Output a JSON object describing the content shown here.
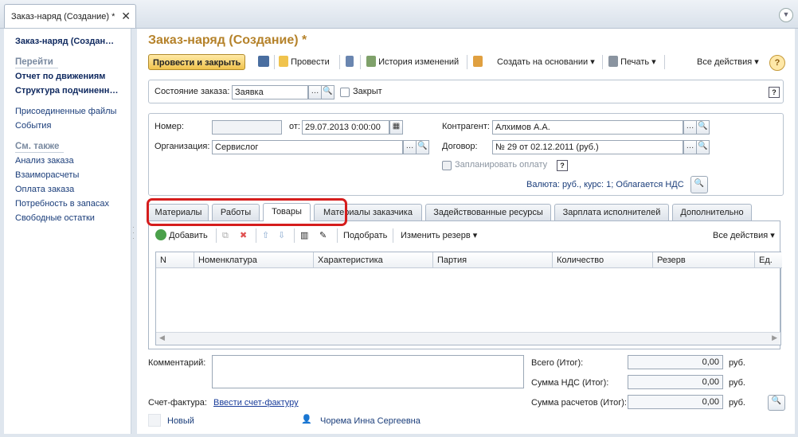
{
  "window": {
    "tab_title": "Заказ-наряд (Создание) *",
    "close_symbol": "✕"
  },
  "sidebar": {
    "title": "Заказ-наряд (Создан…",
    "goto_header": "Перейти",
    "goto_items": [
      "Отчет по движениям",
      "Структура подчиненн…"
    ],
    "misc_items": [
      "Присоединенные файлы",
      "События"
    ],
    "see_also_header": "См. также",
    "see_also_items": [
      "Анализ заказа",
      "Взаиморасчеты",
      "Оплата заказа",
      "Потребность в запасах",
      "Свободные остатки"
    ]
  },
  "header": {
    "title": "Заказ-наряд (Создание) *"
  },
  "toolbar": {
    "post_close": "Провести и закрыть",
    "post": "Провести",
    "history": "История изменений",
    "create_based": "Создать на основании",
    "print": "Печать",
    "all_actions": "Все действия",
    "help": "?"
  },
  "state_panel": {
    "state_label": "Состояние заказа:",
    "state_value": "Заявка",
    "closed_label": "Закрыт",
    "help": "?"
  },
  "form": {
    "number_label": "Номер:",
    "number_value": "",
    "from_label": "от:",
    "date_value": "29.07.2013  0:00:00",
    "org_label": "Организация:",
    "org_value": "Сервислог",
    "counterparty_label": "Контрагент:",
    "counterparty_value": "Алхимов А.А.",
    "contract_label": "Договор:",
    "contract_value": "№ 29 от 02.12.2011 (руб.)",
    "plan_payment_label": "Запланировать оплату",
    "currency_info": "Валюта: руб., курс: 1; Облагается НДС",
    "help": "?"
  },
  "tabs": [
    "Материалы",
    "Работы",
    "Товары",
    "Материалы заказчика",
    "Задействованные ресурсы",
    "Зарплата исполнителей",
    "Дополнительно"
  ],
  "active_tab": "Товары",
  "goods": {
    "add": "Добавить",
    "pick": "Подобрать",
    "change_reserve": "Изменить резерв",
    "all_actions": "Все действия",
    "columns": [
      "N",
      "Номенклатура",
      "Характеристика",
      "Партия",
      "Количество",
      "Резерв",
      "Ед."
    ]
  },
  "footer": {
    "comment_label": "Комментарий:",
    "total_label": "Всего (Итог):",
    "total_value": "0,00",
    "vat_label": "Сумма НДС (Итог):",
    "vat_value": "0,00",
    "settle_label": "Сумма расчетов (Итог):",
    "settle_value": "0,00",
    "currency": "руб.",
    "invoice_label": "Счет-фактура:",
    "invoice_link": "Ввести счет-фактуру",
    "status": "Новый",
    "author": "Чорема Инна Сергеевна"
  },
  "colors": {
    "title": "#b5822a",
    "highlight": "#d51d1d",
    "link": "#1a3d9a"
  }
}
